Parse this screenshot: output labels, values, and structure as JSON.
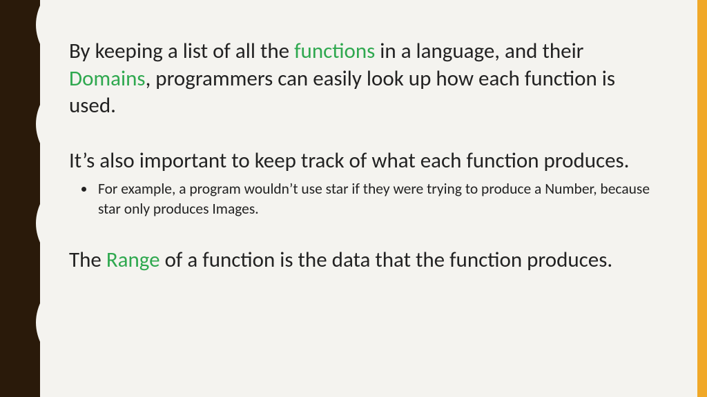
{
  "colors": {
    "highlight": "#2fa84f",
    "leftBar": "#2a1a0a",
    "rightBar": "#f0a828",
    "background": "#f4f3ef"
  },
  "para1": {
    "t1": "By keeping a list of all the ",
    "h1": "functions",
    "t2": " in a language, and their ",
    "h2": "Domains",
    "t3": ", programmers can easily look up how each function is used."
  },
  "para2": "It’s also important to keep track of what each function produces.",
  "bullet1": "For example, a program wouldn’t use star if they were trying to produce a Number, because star only produces Images.",
  "para3": {
    "t1": "The ",
    "h1": "Range",
    "t2": " of a function is the data that the function produces."
  }
}
